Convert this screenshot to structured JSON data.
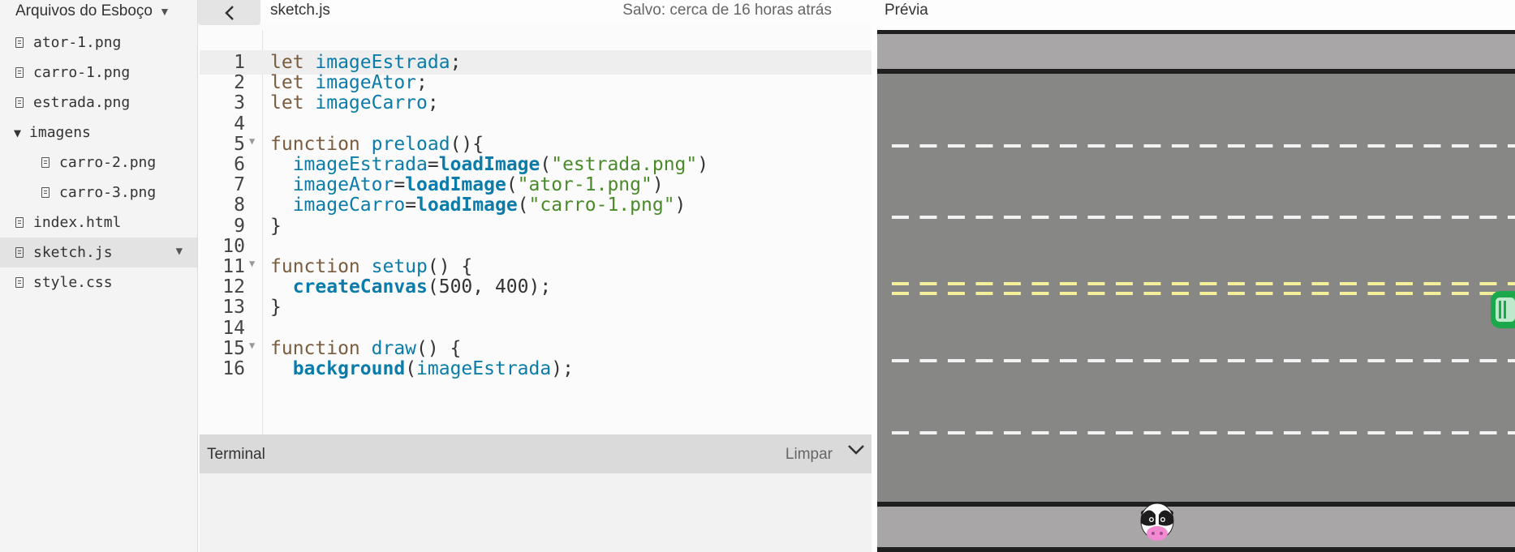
{
  "sidebar": {
    "title": "Arquivos do Esboço",
    "files": [
      {
        "name": "ator-1.png",
        "type": "file"
      },
      {
        "name": "carro-1.png",
        "type": "file"
      },
      {
        "name": "estrada.png",
        "type": "file"
      },
      {
        "name": "imagens",
        "type": "folder"
      },
      {
        "name": "carro-2.png",
        "type": "file",
        "nested": true
      },
      {
        "name": "carro-3.png",
        "type": "file",
        "nested": true
      },
      {
        "name": "index.html",
        "type": "file"
      },
      {
        "name": "sketch.js",
        "type": "file",
        "selected": true
      },
      {
        "name": "style.css",
        "type": "file"
      }
    ]
  },
  "editor": {
    "file_name": "sketch.js",
    "save_status": "Salvo: cerca de 16 horas atrás",
    "line_numbers": [
      "1",
      "2",
      "3",
      "4",
      "5",
      "6",
      "7",
      "8",
      "9",
      "10",
      "11",
      "12",
      "13",
      "14",
      "15",
      "16"
    ],
    "lines": [
      [
        [
          "kw",
          "let "
        ],
        [
          "var",
          "imageEstrada"
        ],
        [
          "punc",
          ";"
        ]
      ],
      [
        [
          "kw",
          "let "
        ],
        [
          "var",
          "imageAtor"
        ],
        [
          "punc",
          ";"
        ]
      ],
      [
        [
          "kw",
          "let "
        ],
        [
          "var",
          "imageCarro"
        ],
        [
          "punc",
          ";"
        ]
      ],
      [],
      [
        [
          "kw",
          "function "
        ],
        [
          "var",
          "preload"
        ],
        [
          "punc",
          "(){"
        ]
      ],
      [
        [
          "punc",
          "  "
        ],
        [
          "var",
          "imageEstrada"
        ],
        [
          "punc",
          "="
        ],
        [
          "fn",
          "loadImage"
        ],
        [
          "punc",
          "("
        ],
        [
          "str",
          "\"estrada.png\""
        ],
        [
          "punc",
          ")"
        ]
      ],
      [
        [
          "punc",
          "  "
        ],
        [
          "var",
          "imageAtor"
        ],
        [
          "punc",
          "="
        ],
        [
          "fn",
          "loadImage"
        ],
        [
          "punc",
          "("
        ],
        [
          "str",
          "\"ator-1.png\""
        ],
        [
          "punc",
          ")"
        ]
      ],
      [
        [
          "punc",
          "  "
        ],
        [
          "var",
          "imageCarro"
        ],
        [
          "punc",
          "="
        ],
        [
          "fn",
          "loadImage"
        ],
        [
          "punc",
          "("
        ],
        [
          "str",
          "\"carro-1.png\""
        ],
        [
          "punc",
          ")"
        ]
      ],
      [
        [
          "punc",
          "}"
        ]
      ],
      [],
      [
        [
          "kw",
          "function "
        ],
        [
          "var",
          "setup"
        ],
        [
          "punc",
          "() {"
        ]
      ],
      [
        [
          "punc",
          "  "
        ],
        [
          "fn",
          "createCanvas"
        ],
        [
          "punc",
          "(500, 400);"
        ]
      ],
      [
        [
          "punc",
          "}"
        ]
      ],
      [],
      [
        [
          "kw",
          "function "
        ],
        [
          "var",
          "draw"
        ],
        [
          "punc",
          "() {"
        ]
      ],
      [
        [
          "punc",
          "  "
        ],
        [
          "fn",
          "background"
        ],
        [
          "punc",
          "("
        ],
        [
          "var",
          "imageEstrada"
        ],
        [
          "punc",
          ");"
        ]
      ]
    ],
    "fold_lines": [
      5,
      11,
      15
    ],
    "active_line": 1
  },
  "terminal": {
    "title": "Terminal",
    "clear_label": "Limpar"
  },
  "preview": {
    "title": "Prévia"
  }
}
